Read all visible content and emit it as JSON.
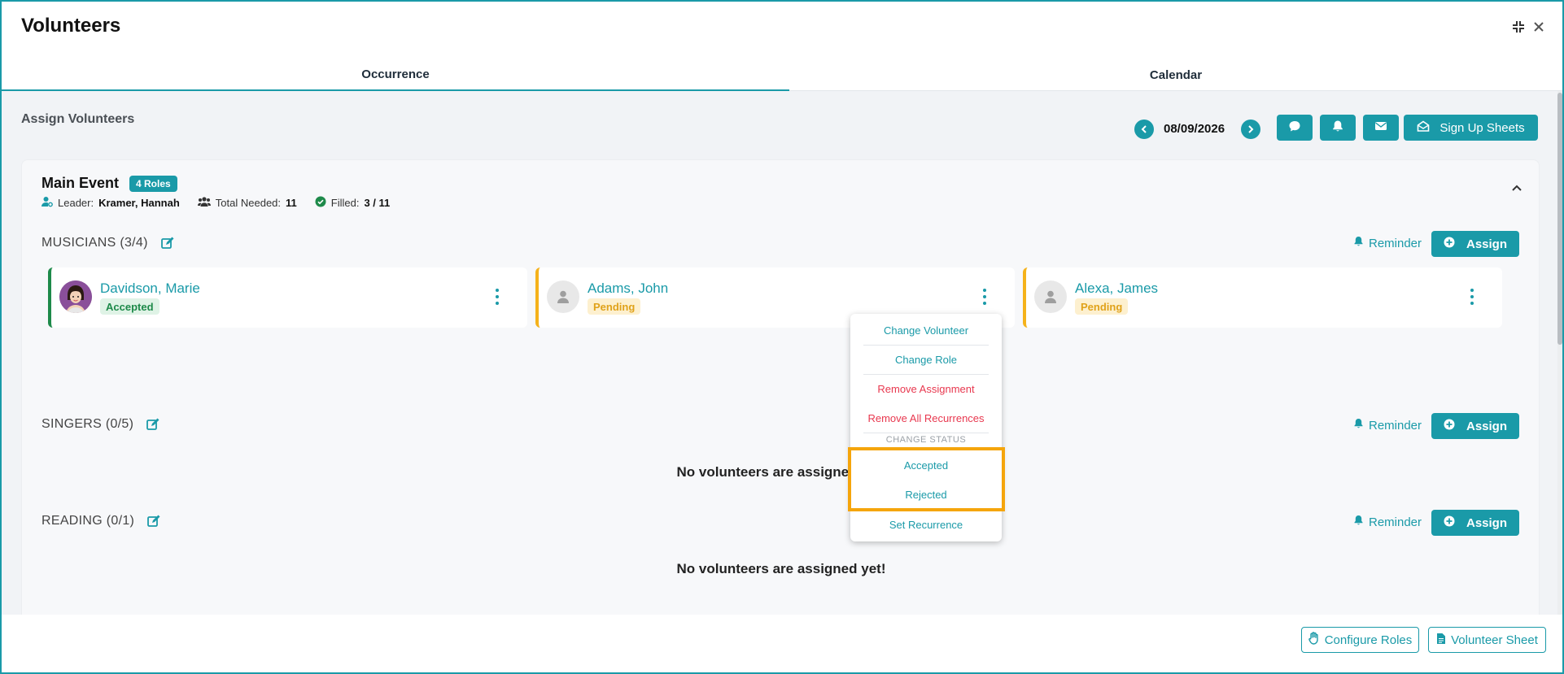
{
  "window": {
    "title": "Volunteers"
  },
  "tabs": [
    {
      "label": "Occurrence",
      "active": true
    },
    {
      "label": "Calendar",
      "active": false
    }
  ],
  "assign": {
    "title": "Assign Volunteers",
    "date": "08/09/2026",
    "signup_label": "Sign Up Sheets"
  },
  "event": {
    "name": "Main Event",
    "roles_badge": "4 Roles",
    "leader_label": "Leader:",
    "leader": "Kramer, Hannah",
    "needed_label": "Total Needed:",
    "needed": "11",
    "filled_label": "Filled:",
    "filled": "3 / 11"
  },
  "roles": [
    {
      "title": "MUSICIANS (3/4)",
      "reminder_label": "Reminder",
      "assign_label": "Assign",
      "volunteers": [
        {
          "name": "Davidson, Marie",
          "status": "Accepted"
        },
        {
          "name": "Adams, John",
          "status": "Pending"
        },
        {
          "name": "Alexa, James",
          "status": "Pending"
        }
      ]
    },
    {
      "title": "SINGERS (0/5)",
      "reminder_label": "Reminder",
      "assign_label": "Assign",
      "empty_message": "No volunteers are assigned yet!"
    },
    {
      "title": "READING (0/1)",
      "reminder_label": "Reminder",
      "assign_label": "Assign",
      "empty_message": "No volunteers are assigned yet!"
    }
  ],
  "menu": {
    "change_volunteer": "Change Volunteer",
    "change_role": "Change Role",
    "remove_assignment": "Remove Assignment",
    "remove_all": "Remove All Recurrences",
    "status_caption": "CHANGE STATUS",
    "accepted": "Accepted",
    "rejected": "Rejected",
    "set_recurrence": "Set Recurrence"
  },
  "footer": {
    "configure_roles": "Configure Roles",
    "volunteer_sheet": "Volunteer Sheet"
  },
  "colors": {
    "accent": "#1a9aa8",
    "accepted": "#1e8a4a",
    "pending": "#f5b21a",
    "danger": "#e8384f",
    "highlight": "#f5a50b"
  },
  "icons": [
    "compress-icon",
    "close-icon",
    "chevron-left-icon",
    "chevron-right-icon",
    "chat-icon",
    "bell-icon",
    "mail-icon",
    "envelope-open-icon",
    "user-cog-icon",
    "users-icon",
    "check-circle-icon",
    "chevron-up-icon",
    "edit-icon",
    "plus-circle-icon",
    "person-icon",
    "kebab-icon",
    "hand-icon",
    "file-icon"
  ]
}
